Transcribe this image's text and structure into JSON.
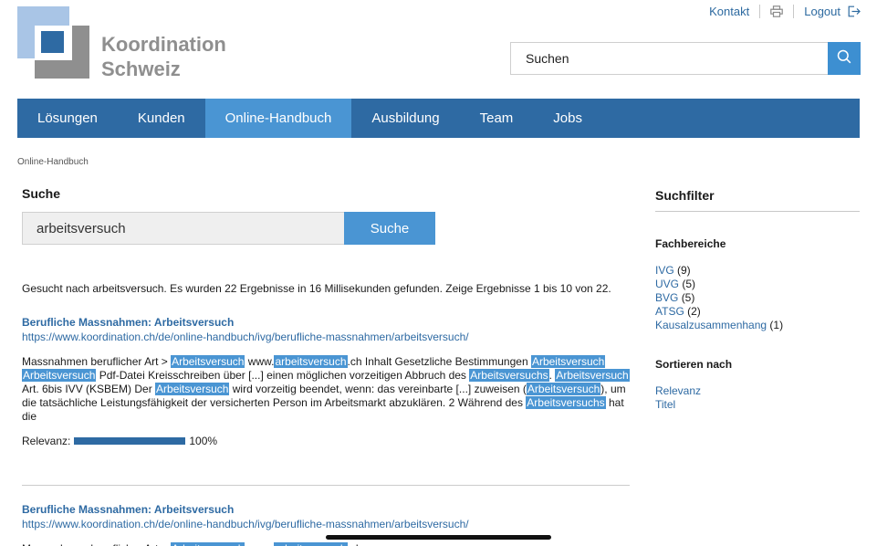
{
  "header": {
    "contact": "Kontakt",
    "logout": "Logout",
    "logo_line1": "Koordination",
    "logo_line2": "Schweiz",
    "search_placeholder": "Suchen"
  },
  "nav": {
    "items": [
      "Lösungen",
      "Kunden",
      "Online-Handbuch",
      "Ausbildung",
      "Team",
      "Jobs"
    ],
    "active": "Online-Handbuch"
  },
  "breadcrumb": "Online-Handbuch",
  "search": {
    "heading": "Suche",
    "query": "arbeitsversuch",
    "button": "Suche",
    "summary": "Gesucht nach arbeitsversuch. Es wurden 22 Ergebnisse in 16 Millisekunden gefunden. Zeige Ergebnisse 1 bis 10 von 22."
  },
  "results": [
    {
      "title": "Berufliche Massnahmen: Arbeitsversuch",
      "url": "https://www.koordination.ch/de/online-handbuch/ivg/berufliche-massnahmen/arbeitsversuch/",
      "snippet": [
        {
          "t": "Massnahmen beruflicher Art > "
        },
        {
          "t": "Arbeitsversuch",
          "hl": true
        },
        {
          "t": " www."
        },
        {
          "t": "arbeitsversuch",
          "hl": true
        },
        {
          "t": ".ch Inhalt Gesetzliche Bestimmungen "
        },
        {
          "t": "Arbeitsversuch",
          "hl": true
        },
        {
          "t": " "
        },
        {
          "t": "Arbeitsversuch",
          "hl": true
        },
        {
          "t": " Pdf-Datei Kreisschreiben über [...] einen möglichen vorzeitigen Abbruch des "
        },
        {
          "t": "Arbeitsversuchs",
          "hl": true
        },
        {
          "t": ". "
        },
        {
          "t": "Arbeitsversuch",
          "hl": true
        },
        {
          "t": " Art. 6bis IVV (KSBEM) Der "
        },
        {
          "t": "Arbeitsversuch",
          "hl": true
        },
        {
          "t": " wird vorzeitig beendet, wenn: das vereinbarte [...] zuweisen ("
        },
        {
          "t": "Arbeitsversuch",
          "hl": true
        },
        {
          "t": "), um die tatsächliche Leistungsfähigkeit der versicherten Person im Arbeitsmarkt abzuklären. 2 Während des "
        },
        {
          "t": "Arbeitsversuchs",
          "hl": true
        },
        {
          "t": " hat die"
        }
      ],
      "relevance_label": "Relevanz:",
      "relevance": "100%"
    },
    {
      "title": "Berufliche Massnahmen: Arbeitsversuch",
      "url": "https://www.koordination.ch/de/online-handbuch/ivg/berufliche-massnahmen/arbeitsversuch/",
      "snippet": [
        {
          "t": "Massnahmen beruflicher Art > "
        },
        {
          "t": "Arbeitsversuch",
          "hl": true
        },
        {
          "t": " www."
        },
        {
          "t": "arbeitsversuch",
          "hl": true
        },
        {
          "t": ".ch"
        }
      ]
    }
  ],
  "sidebar": {
    "heading": "Suchfilter",
    "facets_heading": "Fachbereiche",
    "facets": [
      {
        "label": "IVG",
        "count": "(9)"
      },
      {
        "label": "UVG",
        "count": "(5)"
      },
      {
        "label": "BVG",
        "count": "(5)"
      },
      {
        "label": "ATSG",
        "count": "(2)"
      },
      {
        "label": "Kausalzusammenhang",
        "count": "(1)"
      }
    ],
    "sort_heading": "Sortieren nach",
    "sort_options": [
      "Relevanz",
      "Titel"
    ]
  },
  "icons": {
    "print": "printer-icon",
    "logout": "logout-icon",
    "search": "search-icon"
  },
  "colors": {
    "primary": "#2e6aa3",
    "accent": "#4a95d3",
    "logo_gray": "#8f8f8f",
    "logo_light": "#a9c5e6"
  }
}
